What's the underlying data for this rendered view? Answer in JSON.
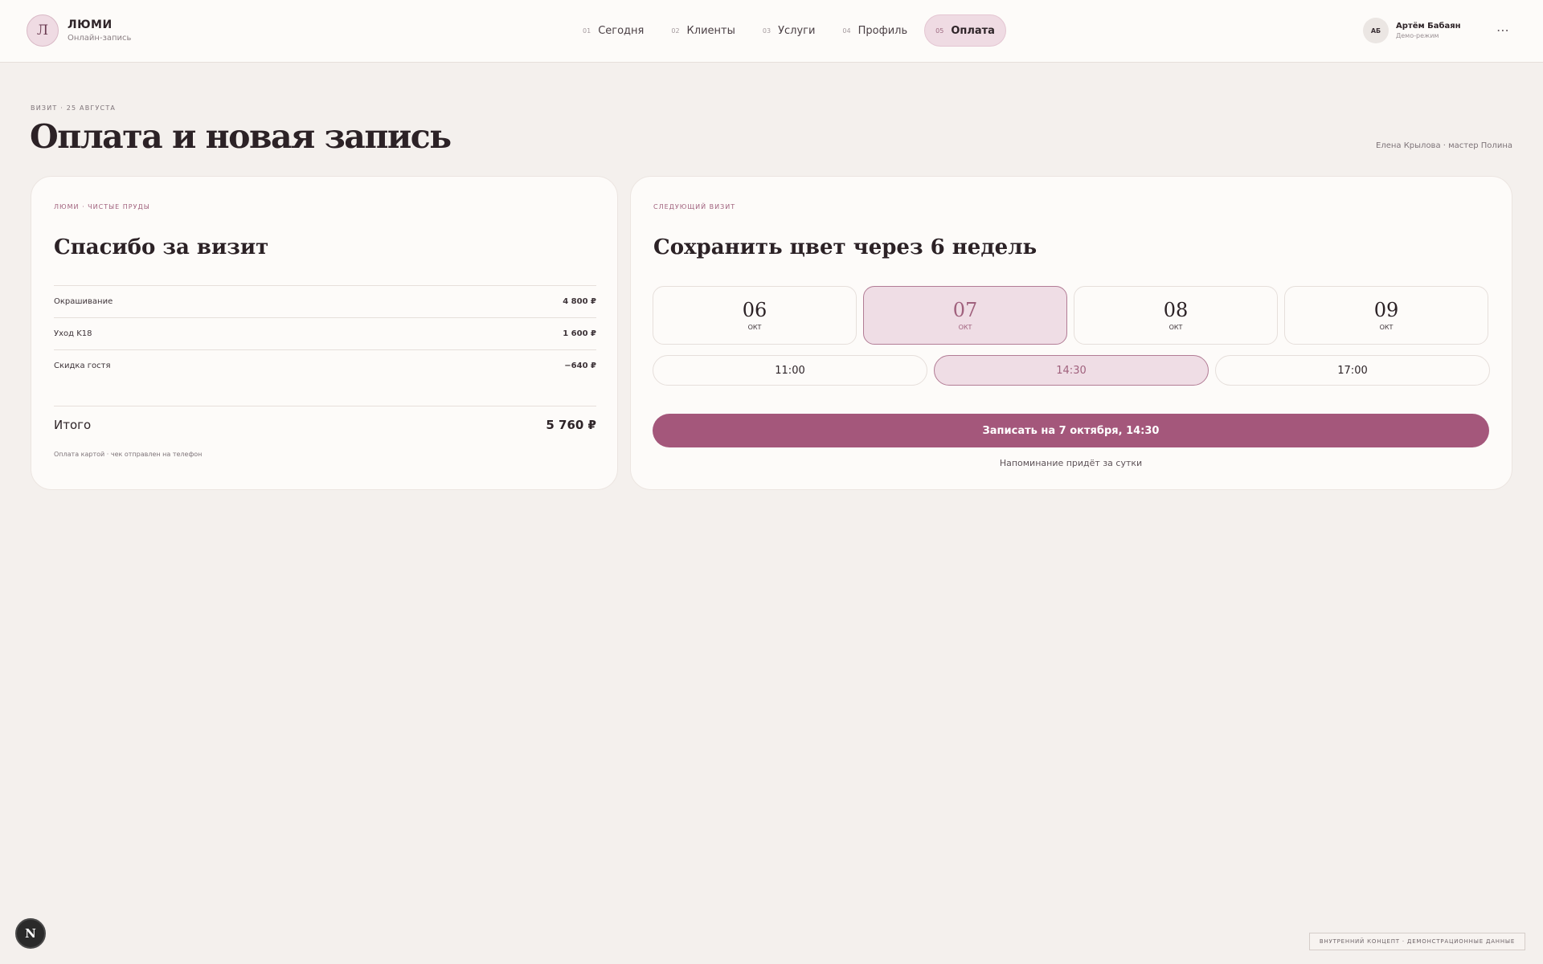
{
  "brand": {
    "logo_letter": "Л",
    "name": "ЛЮМИ",
    "subtitle": "Онлайн-запись"
  },
  "nav": [
    {
      "num": "01",
      "label": "Сегодня",
      "active": false
    },
    {
      "num": "02",
      "label": "Клиенты",
      "active": false
    },
    {
      "num": "03",
      "label": "Услуги",
      "active": false
    },
    {
      "num": "04",
      "label": "Профиль",
      "active": false
    },
    {
      "num": "05",
      "label": "Оплата",
      "active": true
    }
  ],
  "user": {
    "initials": "АБ",
    "name": "Артём Бабаян",
    "mode": "Демо-режим",
    "more_icon": "⋯"
  },
  "page": {
    "eyebrow": "Визит · 25 августа",
    "title": "Оплата и новая запись",
    "meta": "Елена Крылова · мастер Полина"
  },
  "receipt": {
    "eyebrow": "Люми · Чистые пруды",
    "title": "Спасибо за визит",
    "items": [
      {
        "name": "Окрашивание",
        "price": "4 800 ₽"
      },
      {
        "name": "Уход K18",
        "price": "1 600 ₽"
      },
      {
        "name": "Скидка гостя",
        "price": "−640 ₽"
      }
    ],
    "total_label": "Итого",
    "total_value": "5 760 ₽",
    "note": "Оплата картой · чек отправлен на телефон"
  },
  "next_visit": {
    "eyebrow": "Следующий визит",
    "title": "Сохранить цвет через 6 недель",
    "dates": [
      {
        "day": "06",
        "month": "окт",
        "selected": false
      },
      {
        "day": "07",
        "month": "окт",
        "selected": true
      },
      {
        "day": "08",
        "month": "окт",
        "selected": false
      },
      {
        "day": "09",
        "month": "окт",
        "selected": false
      }
    ],
    "times": [
      {
        "label": "11:00",
        "selected": false
      },
      {
        "label": "14:30",
        "selected": true
      },
      {
        "label": "17:00",
        "selected": false
      }
    ],
    "book_label": "Записать на 7 октября, 14:30",
    "reminder": "Напоминание придёт за сутки"
  },
  "footer": {
    "fab_letter": "N",
    "badge": "Внутренний концепт · демонстрационные данные"
  },
  "colors": {
    "accent": "#a4577b",
    "accent_soft": "#efdde5",
    "background": "#f4f0ed",
    "card": "#fdfbf9"
  }
}
